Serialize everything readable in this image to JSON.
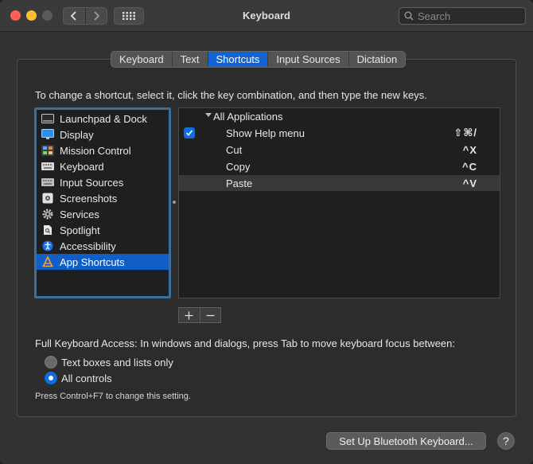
{
  "window": {
    "title": "Keyboard",
    "search_placeholder": "Search"
  },
  "tabs": [
    {
      "label": "Keyboard",
      "active": false
    },
    {
      "label": "Text",
      "active": false
    },
    {
      "label": "Shortcuts",
      "active": true
    },
    {
      "label": "Input Sources",
      "active": false
    },
    {
      "label": "Dictation",
      "active": false
    }
  ],
  "instructions": "To change a shortcut, select it, click the key combination, and then type the new keys.",
  "categories": [
    {
      "label": "Launchpad & Dock",
      "icon": "launchpad-icon"
    },
    {
      "label": "Display",
      "icon": "display-icon"
    },
    {
      "label": "Mission Control",
      "icon": "mission-control-icon"
    },
    {
      "label": "Keyboard",
      "icon": "keyboard-icon"
    },
    {
      "label": "Input Sources",
      "icon": "input-sources-icon"
    },
    {
      "label": "Screenshots",
      "icon": "screenshots-icon"
    },
    {
      "label": "Services",
      "icon": "gear-icon"
    },
    {
      "label": "Spotlight",
      "icon": "spotlight-icon"
    },
    {
      "label": "Accessibility",
      "icon": "accessibility-icon"
    },
    {
      "label": "App Shortcuts",
      "icon": "app-shortcuts-icon",
      "selected": true
    }
  ],
  "shortcuts": {
    "group_label": "All Applications",
    "items": [
      {
        "label": "Show Help menu",
        "keys": "⇧⌘/",
        "checkbox": true
      },
      {
        "label": "Cut",
        "keys": "^X",
        "checkbox": false
      },
      {
        "label": "Copy",
        "keys": "^C",
        "checkbox": false
      },
      {
        "label": "Paste",
        "keys": "^V",
        "checkbox": false
      }
    ]
  },
  "controls": {
    "plus": "+",
    "minus": "−"
  },
  "full_keyboard_access": {
    "label": "Full Keyboard Access: In windows and dialogs, press Tab to move keyboard focus between:",
    "options": [
      {
        "label": "Text boxes and lists only",
        "selected": false
      },
      {
        "label": "All controls",
        "selected": true
      }
    ],
    "hint": "Press Control+F7 to change this setting."
  },
  "bluetooth_button": "Set Up Bluetooth Keyboard...",
  "help_button": "?",
  "colors": {
    "accent": "#0f6dde",
    "selection": "#0f5fc7"
  }
}
